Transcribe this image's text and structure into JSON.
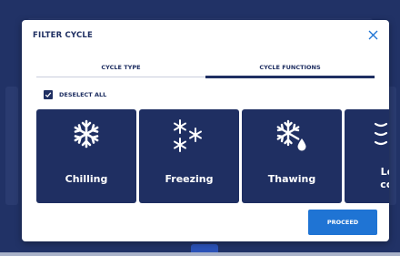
{
  "modal": {
    "title": "FILTER CYCLE",
    "tabs": [
      {
        "label": "CYCLE TYPE",
        "active": false
      },
      {
        "label": "CYCLE FUNCTIONS",
        "active": true
      }
    ],
    "deselect_all": {
      "label": "DESELECT ALL",
      "checked": true
    },
    "cards": [
      {
        "label": "Chilling",
        "icon": "snowflake-icon"
      },
      {
        "label": "Freezing",
        "icon": "three-snowflakes-icon"
      },
      {
        "label": "Thawing",
        "icon": "snowflake-drop-icon"
      },
      {
        "label": "Low\ncool",
        "icon": "waves-icon"
      }
    ],
    "proceed_label": "PROCEED"
  },
  "colors": {
    "navy": "#1f2f62",
    "accent_blue": "#1f74d4",
    "background": "#213266",
    "white": "#ffffff"
  }
}
